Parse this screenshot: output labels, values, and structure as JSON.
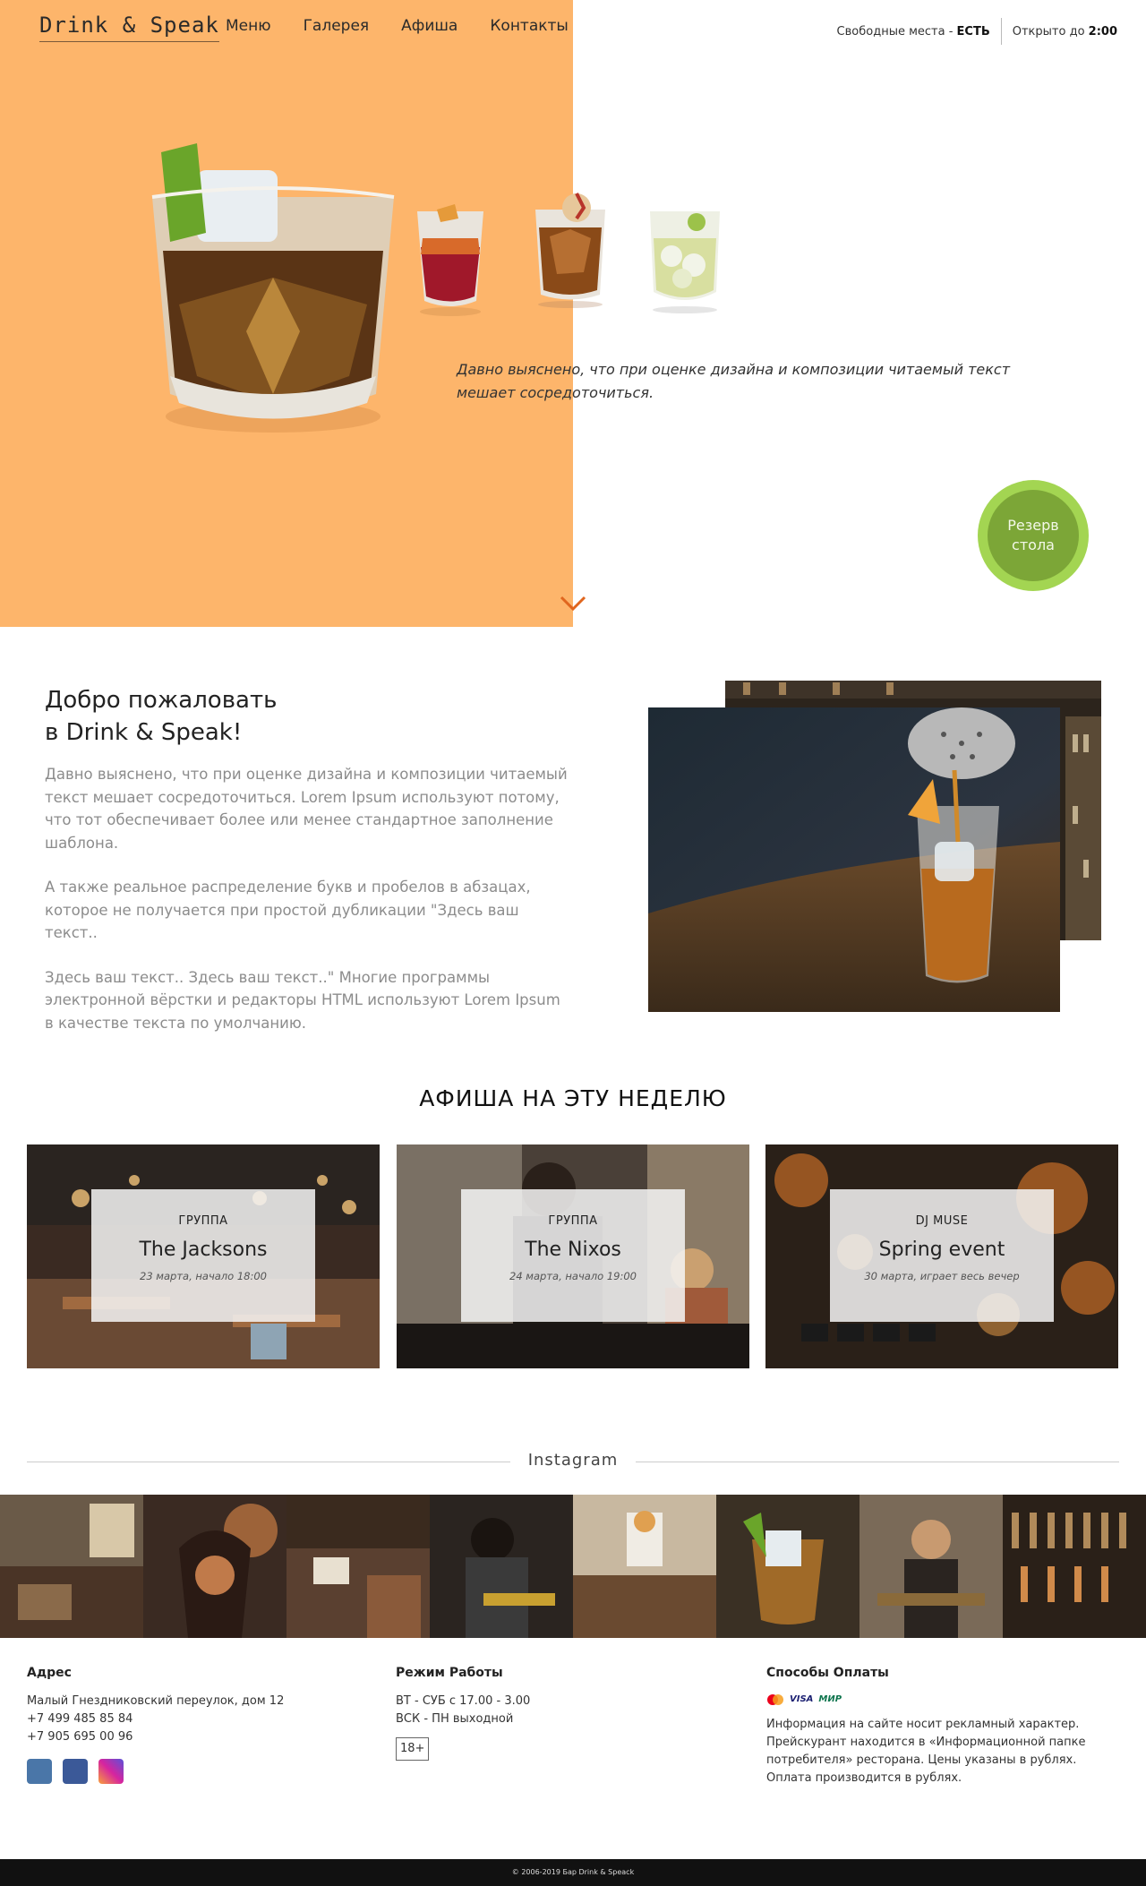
{
  "header": {
    "logo": "Drink & Speak",
    "nav": [
      "Меню",
      "Галерея",
      "Афиша",
      "Контакты"
    ],
    "seats_label": "Свободные места - ",
    "seats_value": "ЕСТЬ",
    "open_label": "Открыто до ",
    "open_value": "2:00"
  },
  "hero": {
    "text": "Давно выяснено, что при оценке дизайна и композиции читаемый текст мешает сосредоточиться.",
    "reserve_label": "Резерв стола"
  },
  "welcome": {
    "title_line1": "Добро пожаловать",
    "title_line2": "в Drink & Speak!",
    "paragraphs": [
      "Давно выяснено, что при оценке дизайна и композиции читаемый текст мешает сосредоточиться. Lorem Ipsum используют потому, что тот обеспечивает более или менее стандартное заполнение шаблона.",
      "А также реальное распределение букв и пробелов в абзацах, которое не получается при простой дубликации \"Здесь ваш текст..",
      "Здесь ваш текст.. Здесь ваш текст..\" Многие программы электронной вёрстки и редакторы HTML используют Lorem Ipsum в качестве текста по умолчанию."
    ]
  },
  "afisha": {
    "title": "АФИША  НА ЭТУ НЕДЕЛЮ",
    "events": [
      {
        "kind": "ГРУППА",
        "name": "The Jacksons",
        "date": "23 марта, начало 18:00"
      },
      {
        "kind": "ГРУППА",
        "name": "The Nixos",
        "date": "24 марта, начало 19:00"
      },
      {
        "kind": "DJ MUSE",
        "name": "Spring event",
        "date": "30 марта, играет весь вечер"
      }
    ]
  },
  "instagram": {
    "title": "Instagram"
  },
  "footer": {
    "address_title": "Адрес",
    "address": "Малый Гнездниковский переулок, дом 12",
    "phone1": "+7 499 485 85 84",
    "phone2": "+7 905 695 00 96",
    "hours_title": "Режим Работы",
    "hours1": "ВТ - СУБ с 17.00 - 3.00",
    "hours2": "ВСК - ПН   выходной",
    "age": "18+",
    "payment_title": "Способы Оплаты",
    "payment_visa": "VISA",
    "payment_mir": "МИР",
    "payment_text": "Информация на сайте носит рекламный характер. Прейскурант находится в «Информационной папке потребителя» ресторана. Цены указаны в рублях. Оплата производится в рублях.",
    "copyright": "© 2006-2019 Бар Drink & Speack"
  },
  "colors": {
    "hero_orange": "#fdb56b",
    "reserve_green": "#7ca637",
    "reserve_ring": "#a3d552",
    "arrow_orange": "#e0661e"
  }
}
